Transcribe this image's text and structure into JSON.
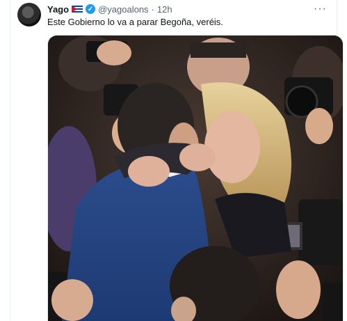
{
  "tweet": {
    "author_name": "Yago",
    "handle": "@yagoalons",
    "separator": "·",
    "time": "12h",
    "text": "Este Gobierno lo va a parar Begoña, veréis.",
    "more_icon": "more-horizontal-icon",
    "verified_icon": "verified-badge-icon",
    "flag_icon": "cuba-flag-icon",
    "verified_glyph": "✓",
    "more_glyph": "···"
  },
  "media": {
    "photo": "photo-kiss-among-photographers"
  },
  "colors": {
    "accent": "#1d9bf0",
    "text": "#0f1419",
    "secondary": "#536471",
    "divider": "#e6ecf0"
  }
}
